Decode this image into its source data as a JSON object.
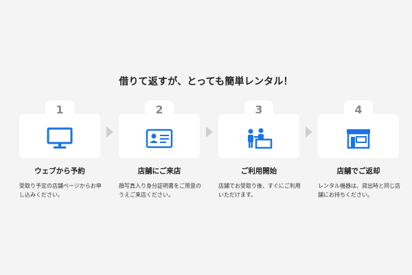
{
  "section": {
    "title": "借りて返すが、とっても簡単レンタル！"
  },
  "steps": [
    {
      "number": "1",
      "title": "ウェブから予約",
      "desc": "受取り予定の店舗ページからお申し込みください。",
      "icon": "monitor-icon"
    },
    {
      "number": "2",
      "title": "店舗にご来店",
      "desc": "顔写真入り身分証明書をご用意のうえご来店ください。",
      "icon": "id-card-icon"
    },
    {
      "number": "3",
      "title": "ご利用開始",
      "desc": "店舗でお受取り後、すぐにご利用いただけます。",
      "icon": "counter-staff-icon"
    },
    {
      "number": "4",
      "title": "店舗でご返却",
      "desc": "レンタル機器は、貸出時と同じ店舗にお持ちください。",
      "icon": "store-icon"
    }
  ],
  "colors": {
    "accent": "#1a73e8",
    "number": "#8a8a8a",
    "arrow": "#cfcfcf",
    "background": "#f4f4f5"
  }
}
